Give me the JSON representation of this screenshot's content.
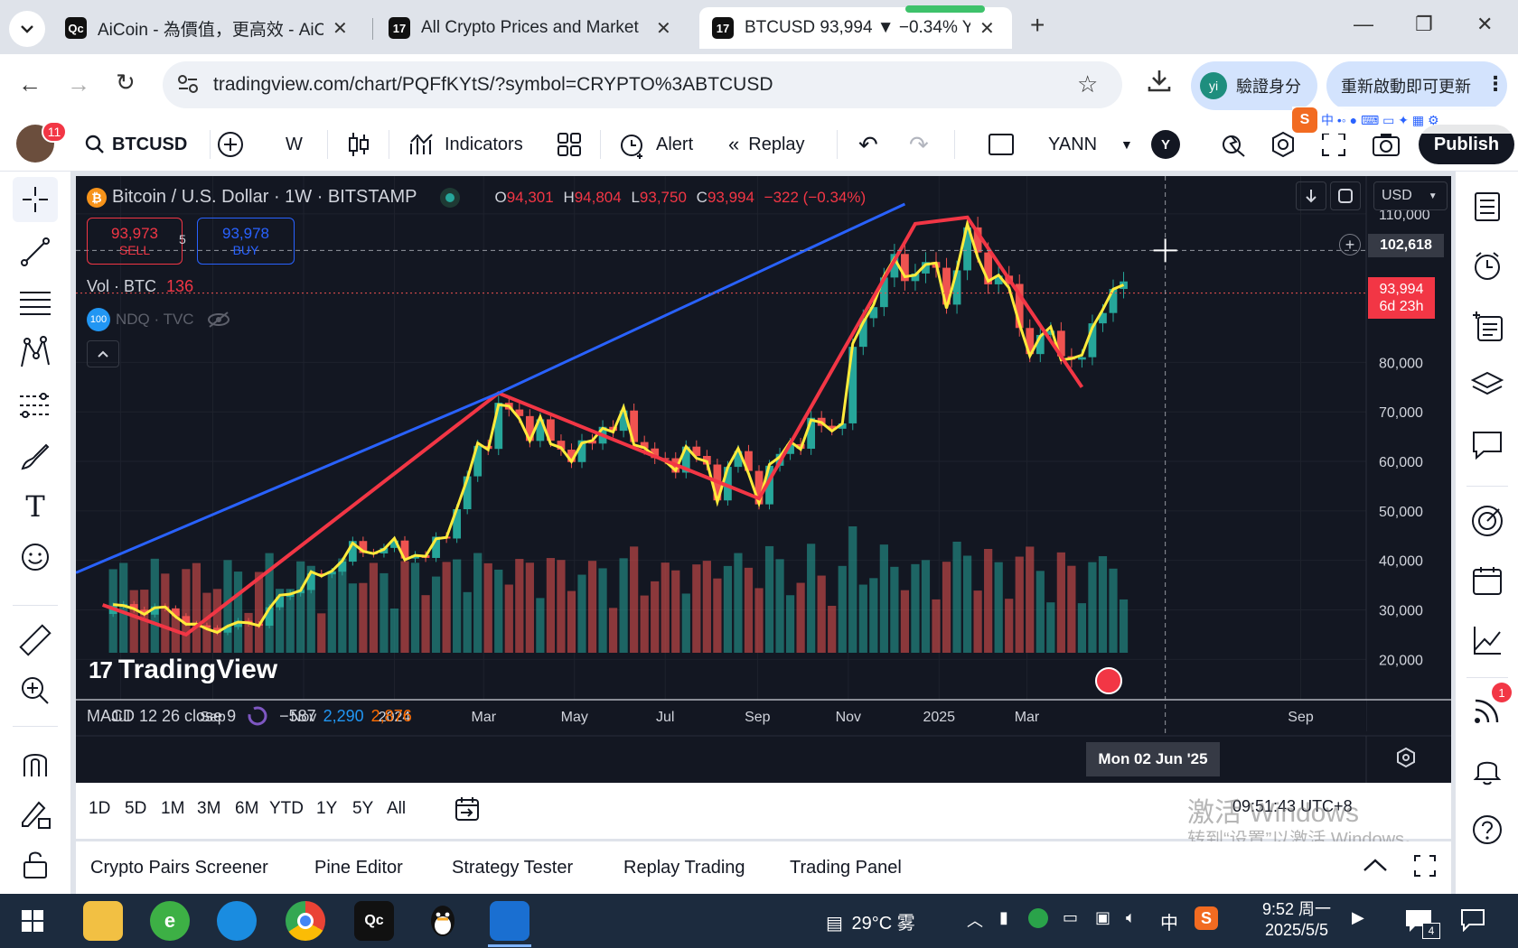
{
  "browser": {
    "tabs": [
      {
        "favicon": "Qc",
        "title": "AiCoin - 為價值，更高效 - AiC"
      },
      {
        "favicon": "17",
        "title": "All Crypto Prices and Market"
      },
      {
        "favicon": "17",
        "title": "BTCUSD 93,994 ▼ −0.34% YA"
      }
    ],
    "new_tab": "+",
    "url": "tradingview.com/chart/PQFfKYtS/?symbol=CRYPTO%3ABTCUSD",
    "profile_initials": "yi",
    "profile_label": "驗證身分",
    "update_label": "重新啟動即可更新"
  },
  "toolbar": {
    "avatar_badge": "11",
    "symbol": "BTCUSD",
    "interval": "W",
    "indicators": "Indicators",
    "alert": "Alert",
    "replay": "Replay",
    "layout_name": "YANN",
    "user_initial": "Y",
    "publish": "Publish"
  },
  "legend": {
    "title": "Bitcoin / U.S. Dollar · 1W · BITSTAMP",
    "o_label": "O",
    "o": "94,301",
    "h_label": "H",
    "h": "94,804",
    "l_label": "L",
    "l": "93,750",
    "c_label": "C",
    "c": "93,994",
    "change": "−322 (−0.34%)",
    "sell_price": "93,973",
    "sell_label": "SELL",
    "spread": "5",
    "buy_price": "93,978",
    "buy_label": "BUY",
    "vol_label": "Vol · BTC",
    "vol_value": "136",
    "ndq_icon_text": "100",
    "ndq_label": "NDQ · TVC",
    "macd_label": "MACD 12 26 close 9",
    "macd_v1": "−587",
    "macd_v2": "2,290",
    "macd_v3": "2,876",
    "watermark": "TradingView"
  },
  "price_axis": {
    "currency": "USD",
    "crosshair_price": "102,618",
    "last_price": "93,994",
    "countdown": "6d 23h"
  },
  "time_axis": {
    "crosshair_date": "Mon 02 Jun '25"
  },
  "footer": {
    "ranges": [
      "1D",
      "5D",
      "1M",
      "3M",
      "6M",
      "YTD",
      "1Y",
      "5Y",
      "All"
    ],
    "clock": "09:51:43 UTC+8"
  },
  "watermark_os": {
    "line1": "激活 Windows",
    "line2": "转到“设置”以激活 Windows。"
  },
  "bottom_tabs": [
    "Crypto Pairs Screener",
    "Pine Editor",
    "Strategy Tester",
    "Replay Trading",
    "Trading Panel"
  ],
  "taskbar": {
    "weather": "29°C 雾",
    "ime": "中",
    "time": "9:52 周一",
    "date": "2025/5/5",
    "notif_count": "4"
  },
  "right_badge": "1",
  "colors": {
    "chart_bg": "#131722",
    "up": "#26a69a",
    "down": "#ef5350",
    "trend_blue": "#2962ff",
    "zigzag_red": "#f23645",
    "zigzag_yellow": "#ffeb3b",
    "accent": "#2962ff"
  },
  "chart_data": {
    "type": "candlestick",
    "title": "Bitcoin / U.S. Dollar · 1W · BITSTAMP",
    "y_ticks": [
      110000,
      80000,
      70000,
      60000,
      50000,
      40000,
      30000,
      20000
    ],
    "y_tick_labels": [
      "110,000",
      "80,000",
      "70,000",
      "60,000",
      "50,000",
      "40,000",
      "30,000",
      "20,000"
    ],
    "ylim": [
      15500,
      114000
    ],
    "x_tick_labels": [
      "Jul",
      "Sep",
      "Nov",
      "2024",
      "Mar",
      "May",
      "Jul",
      "Sep",
      "Nov",
      "2025",
      "Mar",
      "Sep"
    ],
    "x_tick_dates": [
      "2023-07-01",
      "2023-09-01",
      "2023-11-01",
      "2024-01-01",
      "2024-03-01",
      "2024-05-01",
      "2024-07-01",
      "2024-09-01",
      "2024-11-01",
      "2025-01-01",
      "2025-03-01",
      "2025-09-01"
    ],
    "close_path": [
      [
        "2023-06-19",
        30500
      ],
      [
        "2023-07-10",
        30300
      ],
      [
        "2023-08-07",
        29500
      ],
      [
        "2023-08-21",
        26000
      ],
      [
        "2023-09-11",
        26500
      ],
      [
        "2023-10-02",
        27800
      ],
      [
        "2023-10-23",
        34000
      ],
      [
        "2023-11-13",
        37000
      ],
      [
        "2023-12-04",
        42000
      ],
      [
        "2023-12-25",
        42500
      ],
      [
        "2024-01-15",
        41500
      ],
      [
        "2024-01-22",
        40000
      ],
      [
        "2024-02-12",
        50000
      ],
      [
        "2024-02-26",
        62000
      ],
      [
        "2024-03-11",
        70000
      ],
      [
        "2024-03-25",
        69000
      ],
      [
        "2024-04-15",
        64000
      ],
      [
        "2024-05-06",
        61000
      ],
      [
        "2024-05-20",
        68000
      ],
      [
        "2024-06-10",
        66000
      ],
      [
        "2024-07-01",
        58000
      ],
      [
        "2024-07-15",
        63000
      ],
      [
        "2024-08-05",
        55000
      ],
      [
        "2024-08-19",
        61000
      ],
      [
        "2024-09-02",
        54000
      ],
      [
        "2024-09-23",
        64000
      ],
      [
        "2024-10-14",
        67000
      ],
      [
        "2024-10-28",
        69000
      ],
      [
        "2024-11-11",
        90000
      ],
      [
        "2024-11-25",
        97000
      ],
      [
        "2024-12-16",
        100000
      ],
      [
        "2025-01-06",
        95000
      ],
      [
        "2025-01-20",
        104000
      ],
      [
        "2025-02-10",
        97000
      ],
      [
        "2025-03-03",
        84000
      ],
      [
        "2025-03-24",
        84000
      ],
      [
        "2025-04-07",
        79000
      ],
      [
        "2025-04-21",
        94000
      ],
      [
        "2025-05-05",
        93994
      ]
    ],
    "trendline": [
      [
        "2023-06-01",
        37500
      ],
      [
        "2024-03-11",
        73800
      ],
      [
        "2024-12-09",
        112000
      ]
    ],
    "zigzag": [
      [
        "2023-06-19",
        31000
      ],
      [
        "2023-08-14",
        25000
      ],
      [
        "2024-03-11",
        73800
      ],
      [
        "2024-09-02",
        52500
      ],
      [
        "2024-12-16",
        108000
      ],
      [
        "2025-01-20",
        109300
      ],
      [
        "2025-04-07",
        75000
      ]
    ],
    "last_price": 93994,
    "crosshair_price": 102618,
    "crosshair_date": "2025-06-02"
  }
}
